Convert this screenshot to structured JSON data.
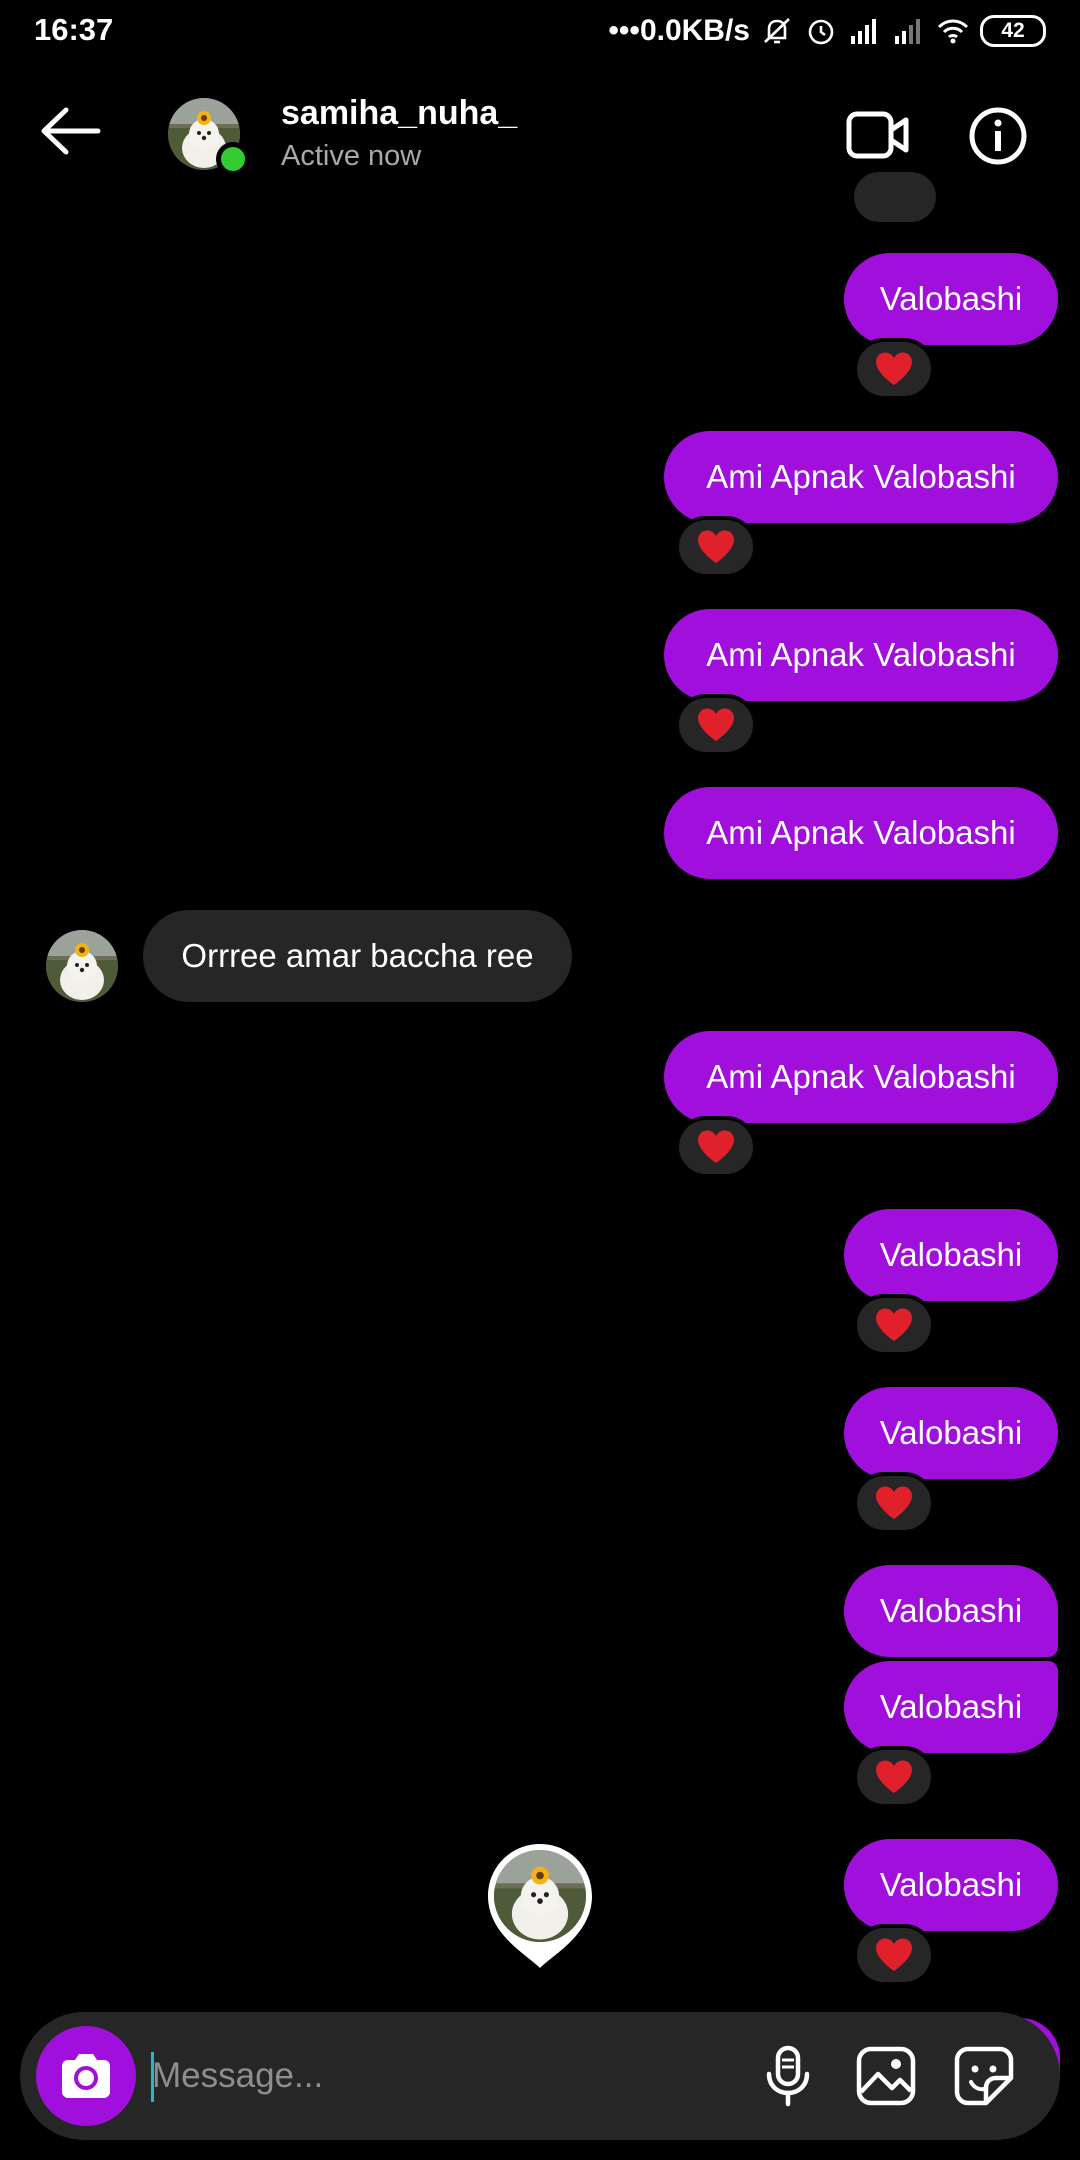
{
  "status_bar": {
    "time": "16:37",
    "network_speed": "0.0KB/s",
    "battery": "42",
    "icons": [
      "dots-icon",
      "mute-icon",
      "alarm-icon",
      "signal-icon",
      "signal-icon",
      "wifi-icon",
      "battery-icon"
    ]
  },
  "header": {
    "username": "samiha_nuha_",
    "status": "Active now",
    "icons": [
      "back-arrow-icon",
      "video-call-icon",
      "info-icon"
    ]
  },
  "messages": [
    {
      "from": "me",
      "text": "Valobashi",
      "reaction": "❤️"
    },
    {
      "from": "me",
      "text": "Ami Apnak Valobashi",
      "reaction": "❤️"
    },
    {
      "from": "me",
      "text": "Ami Apnak Valobashi",
      "reaction": "❤️"
    },
    {
      "from": "me",
      "text": "Ami Apnak Valobashi",
      "reaction": ""
    },
    {
      "from": "them",
      "text": "Orrree amar baccha ree",
      "reaction": ""
    },
    {
      "from": "me",
      "text": "Ami Apnak Valobashi",
      "reaction": "❤️"
    },
    {
      "from": "me",
      "text": "Valobashi",
      "reaction": "❤️"
    },
    {
      "from": "me",
      "text": "Valobashi",
      "reaction": "❤️"
    },
    {
      "from": "me",
      "text": "Valobashi",
      "reaction": ""
    },
    {
      "from": "me",
      "text": "Valobashi",
      "reaction": "❤️"
    },
    {
      "from": "me",
      "text": "Valobashi",
      "reaction": "❤️"
    }
  ],
  "composer": {
    "placeholder": "Message...",
    "icons": [
      "camera-icon",
      "microphone-icon",
      "gallery-icon",
      "sticker-icon"
    ]
  },
  "colors": {
    "background": "#000000",
    "outgoing_bubble": "#a10fdc",
    "incoming_bubble": "#262626",
    "online": "#33cc33",
    "heart": "#e0202a"
  }
}
